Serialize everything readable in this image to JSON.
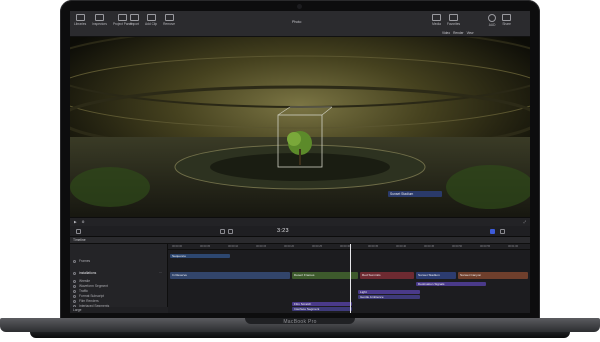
{
  "device": {
    "brand_label": "MacBook Pro"
  },
  "toolbar": {
    "left_buttons": [
      {
        "label": "Libraries",
        "icon": "library-icon"
      },
      {
        "label": "Inspectors",
        "icon": "inspector-icon"
      },
      {
        "label": "Project Panel",
        "icon": "project-panel-icon"
      }
    ],
    "mid_buttons": [
      {
        "label": "Import",
        "icon": "import-icon"
      },
      {
        "label": "Add Clip",
        "icon": "add-clip-icon"
      },
      {
        "label": "Remove",
        "icon": "remove-icon"
      }
    ],
    "title": "Photo",
    "right_buttons": [
      {
        "label": "Media",
        "icon": "media-icon"
      },
      {
        "label": "Favorites",
        "icon": "favorites-icon"
      },
      {
        "label": "AUD",
        "icon": "audio-icon"
      },
      {
        "label": "Share",
        "icon": "share-icon"
      }
    ],
    "view_chips": [
      "Video",
      "Render",
      "View"
    ]
  },
  "viewer": {
    "subject": "cooling-tower interior with green tree in glass cube",
    "overlay_badge": "Sunset Stadium",
    "timecode": "3:23",
    "accent": "#2a3a6a"
  },
  "timeline": {
    "title": "Timeline",
    "index_rows": [
      {
        "label": "Frames"
      },
      {
        "label": "installations"
      },
      {
        "label": "Wrestle"
      },
      {
        "label": "Waveform Segment"
      },
      {
        "label": "Traffic"
      },
      {
        "label": "Format Subscript"
      },
      {
        "label": "Film Renders"
      },
      {
        "label": "Interlaced Segments"
      }
    ],
    "footer_label": "Large",
    "ruler_ticks": [
      "00:00:00",
      "00:00:05",
      "00:00:10",
      "00:00:15",
      "00:00:20",
      "00:00:25",
      "00:00:30",
      "00:00:35",
      "00:00:40",
      "00:00:45",
      "00:00:50",
      "00:00:55",
      "00:01:00"
    ],
    "clips": [
      {
        "label": "Sequence",
        "track": 0,
        "color": "#2d4770",
        "kind": "small"
      },
      {
        "label": "In Reserve",
        "track": 1,
        "color": "#32456b",
        "kind": "main"
      },
      {
        "label": "Desert Frames",
        "track": 1,
        "color": "#3d5a2c",
        "kind": "main"
      },
      {
        "label": "Red Summits",
        "track": 1,
        "color": "#6e2a31",
        "kind": "main"
      },
      {
        "label": "Sunset Stadium",
        "track": 1,
        "color": "#2c3c70",
        "kind": "main"
      },
      {
        "label": "Sunset Canyon",
        "track": 1,
        "color": "#6f3f2c",
        "kind": "main"
      },
      {
        "label": "Destination Signals",
        "track": 2,
        "color": "#4a3a8a",
        "kind": "small"
      },
      {
        "label": "Light",
        "track": 3,
        "color": "#4a3a8a",
        "kind": "small"
      },
      {
        "label": "Gentle Ambience",
        "track": 3,
        "color": "#3e3a7a",
        "kind": "small"
      },
      {
        "label": "Film Scratch",
        "track": 4,
        "color": "#4a3a8a",
        "kind": "small"
      },
      {
        "label": "Interface Segment",
        "track": 4,
        "color": "#3e3a7a",
        "kind": "small"
      }
    ]
  }
}
